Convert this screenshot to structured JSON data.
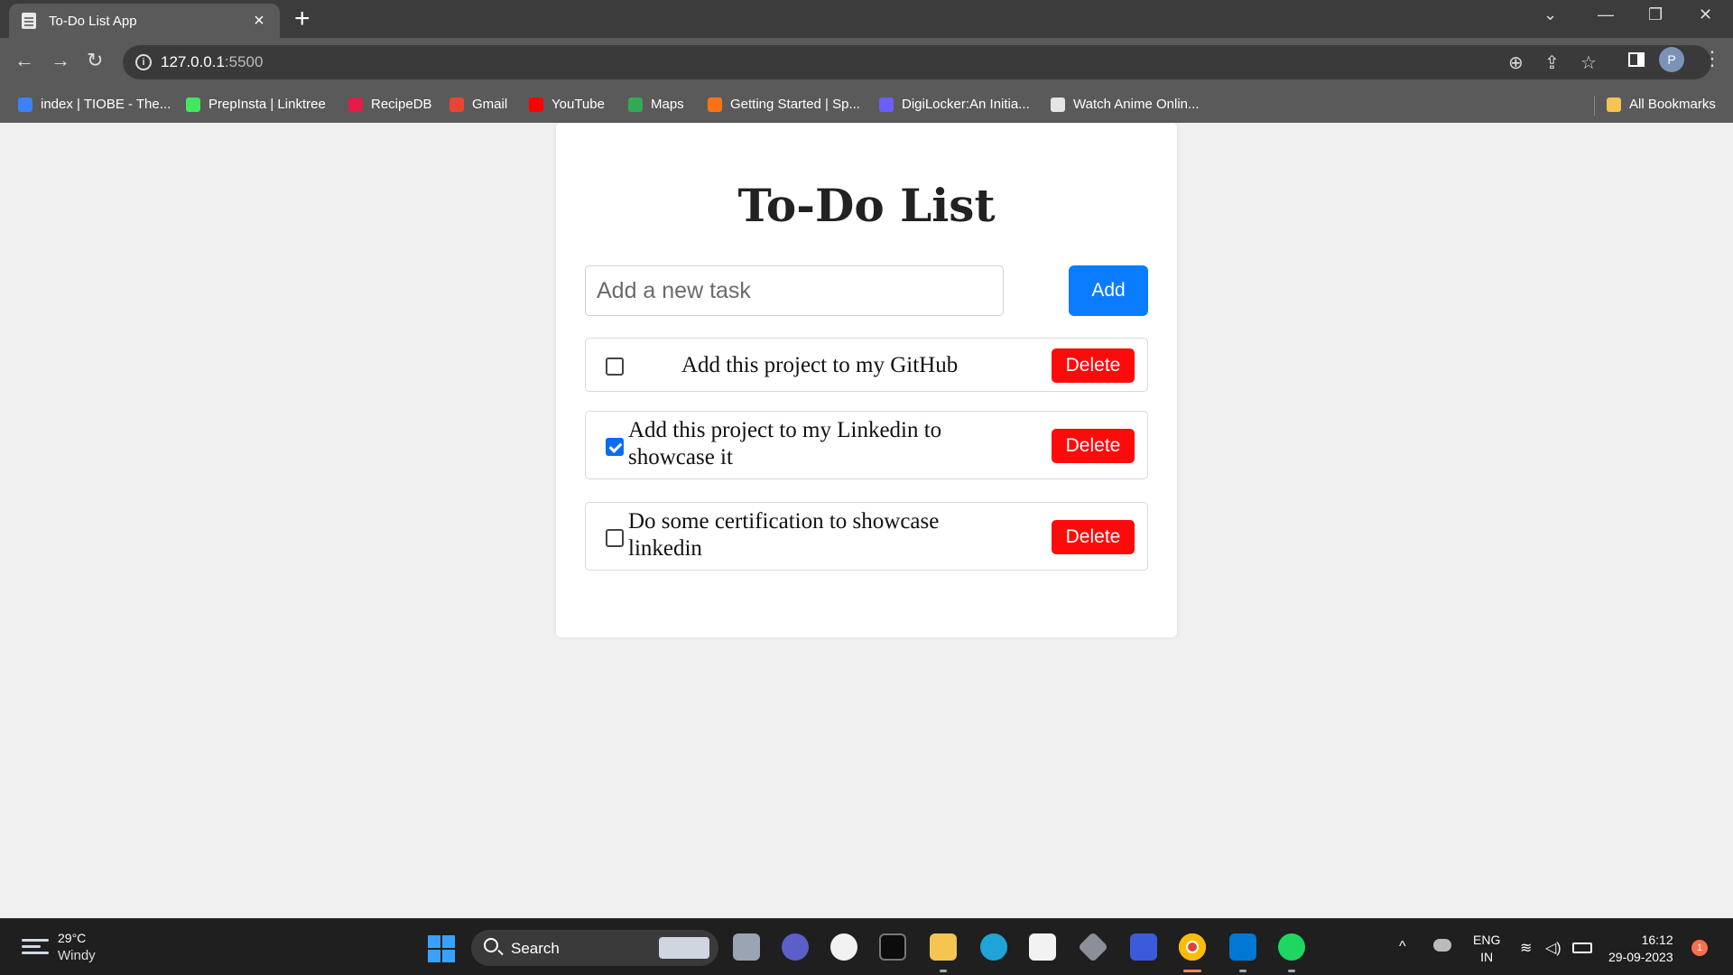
{
  "browser": {
    "tab_title": "To-Do List App",
    "url_host": "127.0.0.1",
    "url_port": ":5500",
    "profile_initial": "P",
    "bookmarks": [
      {
        "label": "index | TIOBE - The...",
        "color": "#3b82f6"
      },
      {
        "label": "PrepInsta | Linktree",
        "color": "#43e660"
      },
      {
        "label": "RecipeDB",
        "color": "#e11d48"
      },
      {
        "label": "Gmail",
        "color": "#ea4335"
      },
      {
        "label": "YouTube",
        "color": "#ff0000"
      },
      {
        "label": "Maps",
        "color": "#34a853"
      },
      {
        "label": "Getting Started | Sp...",
        "color": "#f97316"
      },
      {
        "label": "DigiLocker:An Initia...",
        "color": "#6d5dfc"
      },
      {
        "label": "Watch Anime Onlin...",
        "color": "#e5e5e5"
      }
    ],
    "all_bookmarks": "All Bookmarks"
  },
  "app": {
    "title": "To-Do List",
    "input_placeholder": "Add a new task",
    "input_value": "",
    "add_label": "Add",
    "tasks": [
      {
        "text": "Add this project to my GitHub",
        "done": false,
        "delete_label": "Delete"
      },
      {
        "text": "Add this project to my Linkedin to showcase it",
        "done": true,
        "delete_label": "Delete"
      },
      {
        "text": "Do some certification to showcase linkedin",
        "done": false,
        "delete_label": "Delete"
      }
    ],
    "colors": {
      "add_button": "#0a7cff",
      "delete_button": "#ff0a0a"
    }
  },
  "taskbar": {
    "temperature": "29°C",
    "condition": "Windy",
    "search_label": "Search",
    "lang_top": "ENG",
    "lang_bottom": "IN",
    "time": "16:12",
    "date": "29-09-2023",
    "notification_count": "1"
  }
}
